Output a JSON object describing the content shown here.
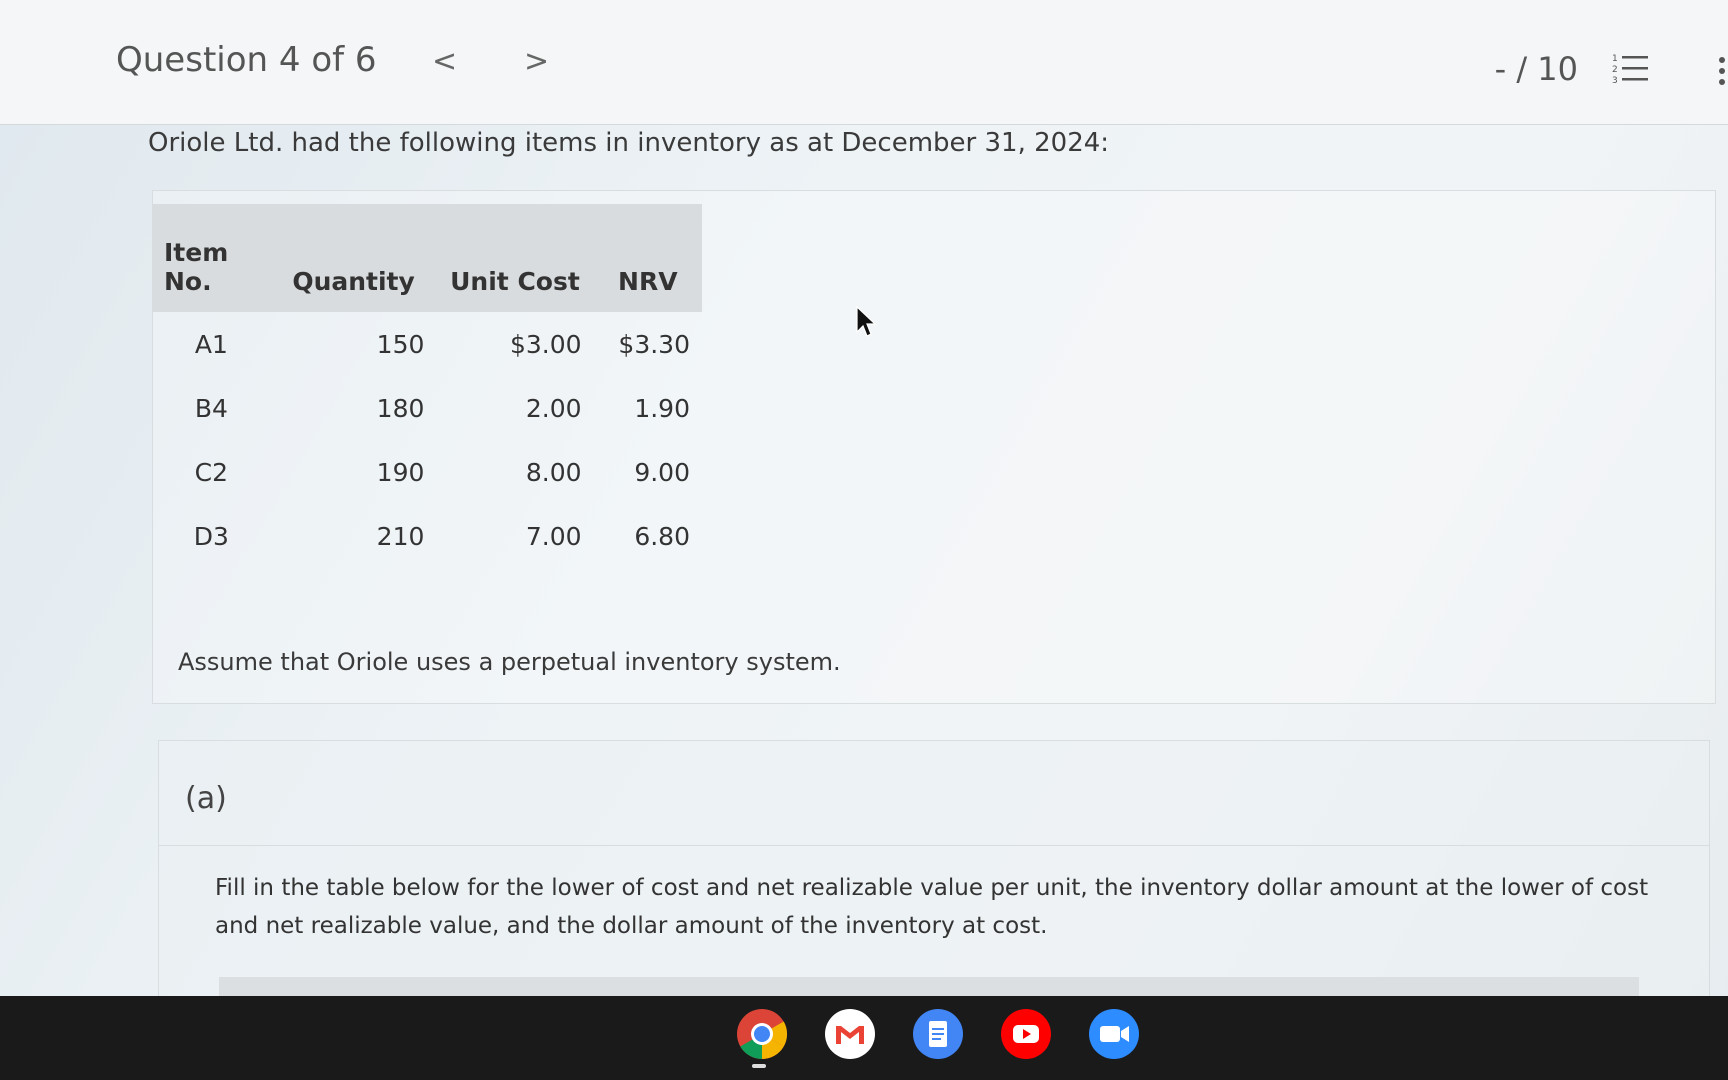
{
  "header": {
    "question_position": "Question 4 of 6",
    "prev_symbol": "<",
    "next_symbol": ">",
    "score": "- / 10"
  },
  "question": {
    "prompt": "Oriole Ltd. had the following items in inventory as at December 31, 2024:",
    "table": {
      "headers": [
        "Item No.",
        "Quantity",
        "Unit Cost",
        "NRV"
      ],
      "rows": [
        [
          "A1",
          "150",
          "$3.00",
          "$3.30"
        ],
        [
          "B4",
          "180",
          "2.00",
          "1.90"
        ],
        [
          "C2",
          "190",
          "8.00",
          "9.00"
        ],
        [
          "D3",
          "210",
          "7.00",
          "6.80"
        ]
      ]
    },
    "assumption": "Assume that Oriole uses a perpetual inventory system."
  },
  "part_a": {
    "label": "(a)",
    "instructions": "Fill in the table below for the lower of cost and net realizable value per unit, the inventory dollar amount at the lower of cost and net realizable value, and the dollar amount of the inventory at cost."
  },
  "icons": {
    "list": "numbered-list-icon",
    "more": "more-options-icon",
    "taskbar": [
      "chrome-icon",
      "gmail-icon",
      "docs-icon",
      "youtube-icon",
      "zoom-icon"
    ]
  },
  "colors": {
    "chrome_red": "#db4437",
    "docs_blue": "#4285f4",
    "youtube_red": "#ff0000",
    "zoom_blue": "#2d8cff"
  }
}
